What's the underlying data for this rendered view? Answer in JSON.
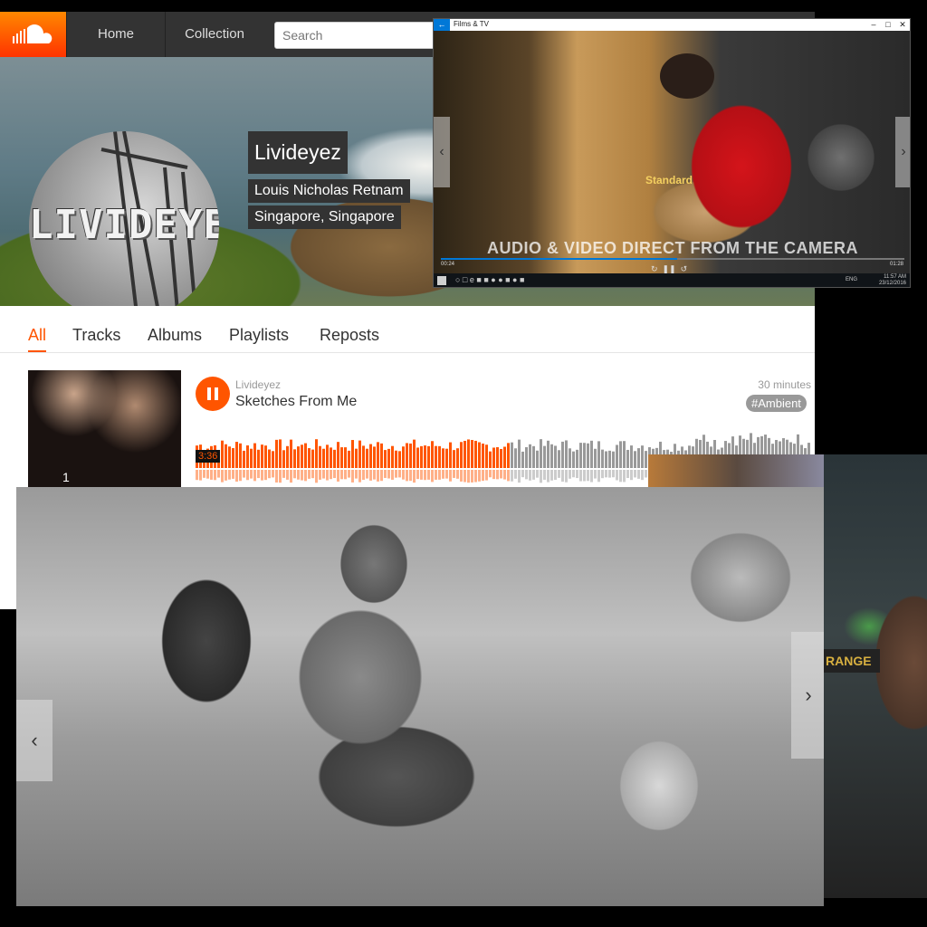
{
  "soundcloud": {
    "nav": {
      "home": "Home",
      "collection": "Collection"
    },
    "search": {
      "placeholder": "Search"
    },
    "profile": {
      "avatar_text": "LIVIDEYEZ",
      "name": "Livideyez",
      "full_name": "Louis Nicholas Retnam",
      "location": "Singapore, Singapore"
    },
    "tabs": [
      "All",
      "Tracks",
      "Albums",
      "Playlists",
      "Reposts"
    ],
    "active_tab": "All",
    "track": {
      "number": "1",
      "artist": "Livideyez",
      "title": "Sketches From Me",
      "duration": "30 minutes",
      "tag": "#Ambient",
      "current_time": "3:36",
      "progress": 0.51
    },
    "colors": {
      "accent": "#ff5500",
      "header": "#333333"
    }
  },
  "films_tv": {
    "title": "Films & TV",
    "caption": "AUDIO & VIDEO DIRECT FROM THE CAMERA",
    "time_elapsed": "00:24",
    "time_remaining": "01:28",
    "progress": 0.51,
    "clock": {
      "time": "11:57 AM",
      "date": "23/12/2016"
    },
    "lang": "ENG",
    "shirt_text": "Standard"
  },
  "bottom_photo": {
    "sign_text": "RANGE"
  }
}
